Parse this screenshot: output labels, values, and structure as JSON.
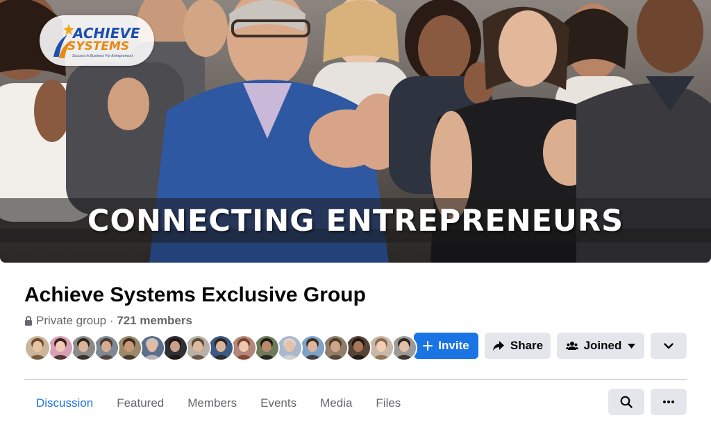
{
  "cover": {
    "headline": "CONNECTING ENTREPRENEURS",
    "logo": {
      "line1": "ACHIEVE",
      "line2": "SYSTEMS",
      "tagline": "Success In Business For Entrepreneurs"
    }
  },
  "group": {
    "title": "Achieve Systems Exclusive Group",
    "privacy": "Private group",
    "separator": " · ",
    "members": "721 members"
  },
  "avatars": [
    {
      "bg": "#c9b59a",
      "skin": "#e8c4a6",
      "hair": "#6b4a2d"
    },
    {
      "bg": "#d8a0b6",
      "skin": "#f1c9b7",
      "hair": "#3a2418"
    },
    {
      "bg": "#8c8a88",
      "skin": "#d9b49a",
      "hair": "#2b211c"
    },
    {
      "bg": "#7d8a94",
      "skin": "#d8ad8f",
      "hair": "#4a3a30"
    },
    {
      "bg": "#9a8a6a",
      "skin": "#c99a77",
      "hair": "#3b2b20"
    },
    {
      "bg": "#5b6f8c",
      "skin": "#e2bba0",
      "hair": "#c9c4bd"
    },
    {
      "bg": "#2f2f33",
      "skin": "#caa08a",
      "hair": "#1a1512"
    },
    {
      "bg": "#b8b0a4",
      "skin": "#e0b99b",
      "hair": "#5b4a3a"
    },
    {
      "bg": "#3d5a86",
      "skin": "#d9b399",
      "hair": "#2e241d"
    },
    {
      "bg": "#b3867a",
      "skin": "#ecc6ae",
      "hair": "#7a3d2a"
    },
    {
      "bg": "#6d7b5a",
      "skin": "#b98a6b",
      "hair": "#1f1915"
    },
    {
      "bg": "#a9b8cf",
      "skin": "#e6c2a8",
      "hair": "#d8d4cc"
    },
    {
      "bg": "#7ea3c7",
      "skin": "#dcb59b",
      "hair": "#3c2e24"
    },
    {
      "bg": "#8e7e6a",
      "skin": "#d0a487",
      "hair": "#4d3b2c"
    },
    {
      "bg": "#574338",
      "skin": "#a97757",
      "hair": "#1b1511"
    },
    {
      "bg": "#c7b8a8",
      "skin": "#efcdb6",
      "hair": "#8a6a4a"
    },
    {
      "bg": "#9c9a98",
      "skin": "#e3bfa6",
      "hair": "#2e2622"
    }
  ],
  "actions": {
    "invite": "Invite",
    "share": "Share",
    "joined": "Joined"
  },
  "tabs": [
    {
      "label": "Discussion",
      "active": true
    },
    {
      "label": "Featured",
      "active": false
    },
    {
      "label": "Members",
      "active": false
    },
    {
      "label": "Events",
      "active": false
    },
    {
      "label": "Media",
      "active": false
    },
    {
      "label": "Files",
      "active": false
    }
  ],
  "icons": {
    "privacy": "lock-icon",
    "invite": "plus-icon",
    "share": "share-arrow-icon",
    "joined": "group-people-icon",
    "joined_caret": "caret-down-icon",
    "more": "chevron-down-icon",
    "search": "search-icon",
    "tab_more": "ellipsis-icon"
  },
  "colors": {
    "accent": "#1b74e4",
    "button_gray": "#e4e6eb",
    "secondary_text": "#65676b",
    "primary_text": "#050505"
  }
}
